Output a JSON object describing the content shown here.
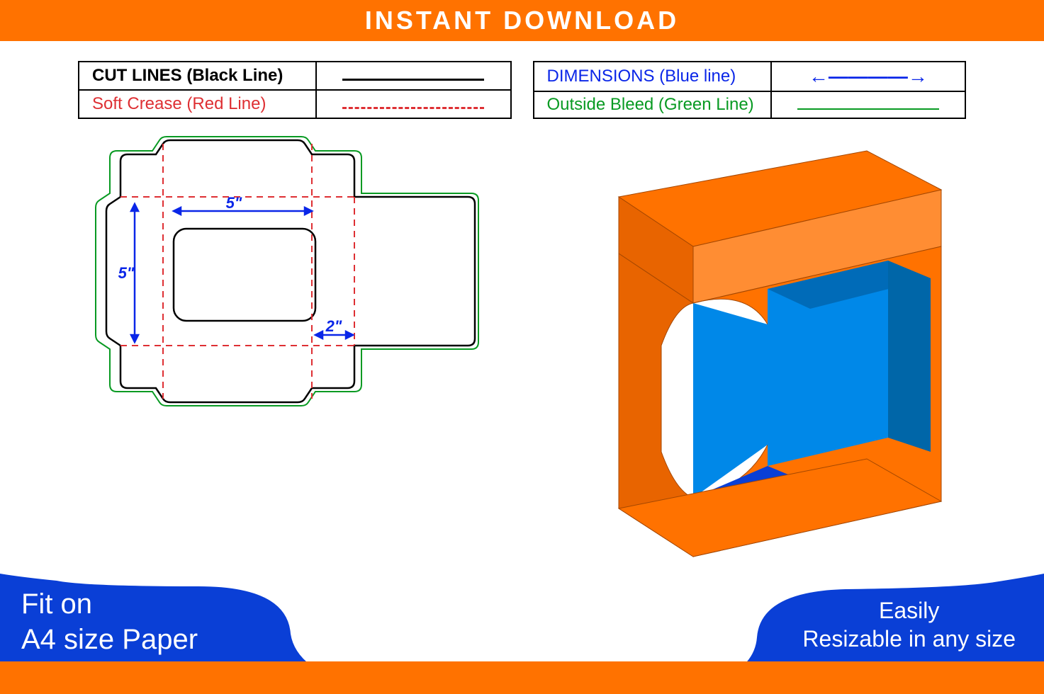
{
  "header": {
    "title": "INSTANT DOWNLOAD"
  },
  "legend": {
    "cut": "CUT LINES (Black Line)",
    "crease": "Soft Crease (Red Line)",
    "dimensions": "DIMENSIONS (Blue line)",
    "bleed": "Outside Bleed (Green Line)"
  },
  "dims": {
    "width": "5\"",
    "height": "5\"",
    "depth": "2\""
  },
  "footer": {
    "left_line1": "Fit on",
    "left_line2": "A4 size Paper",
    "right_line1": "Easily",
    "right_line2": "Resizable in any size"
  },
  "colors": {
    "orange": "#ff7200",
    "blue": "#0a3fd6",
    "boxblue": "#0088e8",
    "red": "#de2f33",
    "green": "#089a22"
  }
}
